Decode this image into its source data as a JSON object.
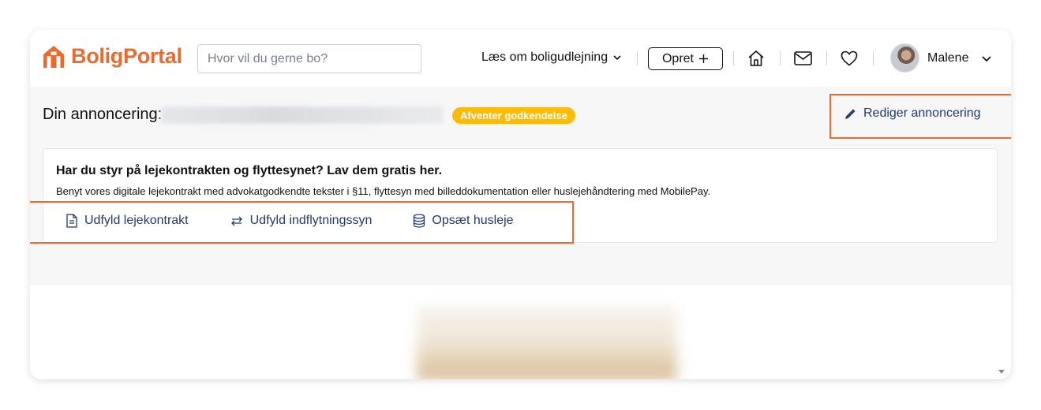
{
  "colors": {
    "brand": "#ed6a2f",
    "badge": "#fbbb07",
    "link": "#233a6c",
    "highlight_box": "#ed6a2f"
  },
  "header": {
    "logo_text": "BoligPortal",
    "search_placeholder": "Hvor vil du gerne bo?",
    "nav_link": "Læs om boligudlejning",
    "create_button": "Opret",
    "icons": [
      "home-icon",
      "mail-icon",
      "heart-icon"
    ],
    "user_name": "Malene"
  },
  "listing": {
    "label": "Din annoncering:",
    "status_badge": "Afventer godkendelse",
    "edit_link": "Rediger annoncering"
  },
  "info": {
    "title": "Har du styr på lejekontrakten og flyttesynet? Lav dem gratis her.",
    "text": "Benyt vores digitale lejekontrakt med advokatgodkendte tekster i §11, flyttesyn med billeddokumentation eller huslejehåndtering med MobilePay.",
    "actions": [
      {
        "label": "Udfyld lejekontrakt",
        "icon": "document-icon"
      },
      {
        "label": "Udfyld indflytningssyn",
        "icon": "swap-arrows-icon"
      },
      {
        "label": "Opsæt husleje",
        "icon": "database-icon"
      }
    ]
  }
}
